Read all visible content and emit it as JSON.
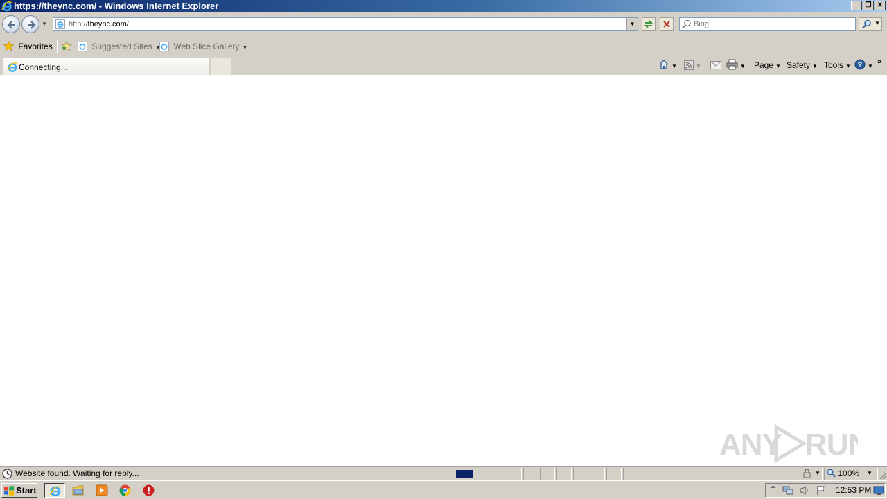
{
  "window": {
    "title": "https://theync.com/ - Windows Internet Explorer",
    "minimize": "_",
    "restore": "❐",
    "close": "✕"
  },
  "address_bar": {
    "url_protocol": "http://",
    "url_host": "theync.com/",
    "search_placeholder": "Bing"
  },
  "favorites_bar": {
    "favorites_label": "Favorites",
    "items": [
      {
        "label": "Suggested Sites"
      },
      {
        "label": "Web Slice Gallery"
      }
    ]
  },
  "tab": {
    "label": "Connecting..."
  },
  "command_bar": {
    "page_label": "Page",
    "safety_label": "Safety",
    "tools_label": "Tools"
  },
  "status_bar": {
    "text": "Website found. Waiting for reply...",
    "zoom": "100%",
    "progress_fraction": 0.27
  },
  "taskbar": {
    "start_label": "Start",
    "clock": "12:53 PM"
  },
  "watermark": {
    "text": "ANY RUN"
  },
  "colors": {
    "title_gradient_start": "#0a246a",
    "title_gradient_end": "#a6caf0",
    "chrome": "#d4d0c8",
    "progress": "#0a246a"
  }
}
